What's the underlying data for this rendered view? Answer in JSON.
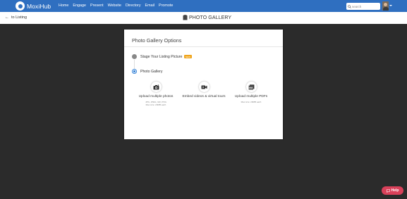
{
  "brand": {
    "name": "MoxiHub"
  },
  "nav": {
    "items": [
      {
        "label": "Home"
      },
      {
        "label": "Engage"
      },
      {
        "label": "Present"
      },
      {
        "label": "Website"
      },
      {
        "label": "Directory"
      },
      {
        "label": "Email"
      },
      {
        "label": "Promote"
      }
    ],
    "search_placeholder": "search",
    "icons": {
      "search": "search-icon",
      "avatar": "user-avatar",
      "menu": "chevron-down-icon"
    }
  },
  "subheader": {
    "back_label": "to Listing",
    "title": "PHOTO GALLERY",
    "title_icon": "folder-icon"
  },
  "card": {
    "title": "Photo Gallery Options",
    "options": [
      {
        "label": "Stage Your Listing Picture",
        "badge": "NEW",
        "selected": false
      },
      {
        "label": "Photo Gallery",
        "selected": true
      }
    ],
    "tiles": [
      {
        "icon": "add-photo-icon",
        "label": "Upload multiple photos",
        "sub1": "JPG, JPEG, GIF, PNG",
        "sub2": "Max size: 20MB each"
      },
      {
        "icon": "video-camera-icon",
        "label": "Embed videos & virtual tours"
      },
      {
        "icon": "pdf-file-icon",
        "label": "Upload multiple PDFs",
        "sub1": "Max size: 20MB each"
      }
    ]
  },
  "help": {
    "label": "Help",
    "icon": "chat-bubble-icon"
  },
  "colors": {
    "nav": "#2f6fc0",
    "background": "#2b2b2b",
    "accent": "#2f7fd6",
    "badge": "#f0a51c",
    "help": "#d9415a"
  }
}
